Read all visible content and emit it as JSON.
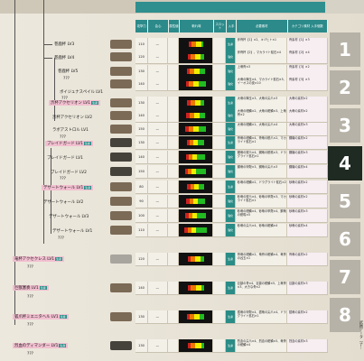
{
  "headers": [
    "攻撃力",
    "会心",
    "属性値",
    "斬れ味",
    "スロット",
    "入手",
    "必要素材",
    "カテゴリ素材\n入手個数"
  ],
  "colors": {
    "teal": "#2c8a8a",
    "pink": "#f2bfd0",
    "dark_tab": "#1f2a22",
    "grey_tab": "#b7b2a7"
  },
  "tree": [
    {
      "label": "巻鹿杯 LV3",
      "tag": ""
    },
    {
      "label": "巻鹿杯 LV4",
      "tag": ""
    },
    {
      "label": "巻鹿杯 LV5",
      "tag": ""
    },
    {
      "label": "ボイジュナスペイル LV1",
      "tag": ""
    },
    {
      "label": "渋杯アクセリオン LV1",
      "tag": "生産"
    },
    {
      "label": "渋杯アクセリオン LV2",
      "tag": ""
    },
    {
      "label": "ラボアストロル LV1",
      "tag": ""
    },
    {
      "label": "ブレイドガード LV1",
      "tag": "生産"
    },
    {
      "label": "ブレイドガード LV1",
      "tag": ""
    },
    {
      "label": "ブレイドガード LV2",
      "tag": ""
    },
    {
      "label": "デザートウォール LV1",
      "tag": "生産"
    },
    {
      "label": "デザートウォール LV2",
      "tag": ""
    },
    {
      "label": "デザートウォール LV3",
      "tag": ""
    },
    {
      "label": "デザートウォール LV1",
      "tag": ""
    },
    {
      "label": "竜杯アクセクレス LV1",
      "tag": "生産"
    },
    {
      "label": "巨獣塞奏 LV1",
      "tag": "生産"
    },
    {
      "label": "狐爪杯ミエニタヘル LV1",
      "tag": "生産"
    },
    {
      "label": "烈血のディマンダー LV1",
      "tag": "生産"
    }
  ],
  "qq": "???",
  "rows": [
    {
      "atk": "110",
      "crit": "—",
      "slot": "",
      "get": "生産",
      "mat": "斧骨杯【1】×2、キヅヒト×1",
      "cat": "骨素材【1】×3"
    },
    {
      "atk": "120",
      "crit": "—",
      "slot": "",
      "get": "強化",
      "mat": "斧骨杯【2】、マカライト鉱石×4",
      "cat": "骨素材【2】×4"
    },
    {
      "atk": "130",
      "crit": "—",
      "slot": "",
      "get": "強化",
      "mat": "上竜骨×3",
      "cat": "骨素材【3】×2"
    },
    {
      "atk": "140",
      "crit": "—",
      "slot": "",
      "get": "強化",
      "mat": "大竜の陣玉×4、マカライト鉱石×5、イーオスの皮×10",
      "cat": "骨素材【3】×3"
    },
    {
      "atk": "130",
      "crit": "—",
      "slot": "",
      "get": "生産",
      "mat": "大竜の陣玉×3、大竜の尖爪×3",
      "cat": "大竜の素材×2"
    },
    {
      "atk": "140",
      "crit": "—",
      "slot": "",
      "get": "強化",
      "mat": "大竜の紺鱗×2、大竜の紺鱗×3、上竜骨×2",
      "cat": "大竜の素材×2"
    },
    {
      "atk": "150",
      "crit": "—",
      "slot": "",
      "get": "強化",
      "mat": "大竜の紺鱗×1、大竜の尖爪×4",
      "cat": "大竜の素材×3"
    },
    {
      "atk": "130",
      "crit": "—",
      "slot": "",
      "get": "生産",
      "mat": "骨竜の紺鱗×4、骨竜の鋭爪×2、マカライト鉱石×1",
      "cat": "鋼機の素材×2"
    },
    {
      "atk": "140",
      "crit": "—",
      "slot": "",
      "get": "強化",
      "mat": "鋼竜の鋭爪×4、鋼竜の鋭嘴×3、ドラグライト鉱石×1",
      "cat": "鋼機の素材×3"
    },
    {
      "atk": "150",
      "crit": "—",
      "slot": "",
      "get": "強化",
      "mat": "鋼竜の甲殻×3、鋼竜の尖爪×3",
      "cat": "鋼機の素材×4"
    },
    {
      "atk": "80",
      "crit": "—",
      "slot": "",
      "get": "生産",
      "mat": "砂竜の紺鱗×2、ドラグライト鉱石×2",
      "cat": "砂竜の素材×2"
    },
    {
      "atk": "90",
      "crit": "—",
      "slot": "",
      "get": "強化",
      "mat": "砂竜の鋭爪×4、砂竜の甲殻×3、マカライト鉱石×1",
      "cat": "砂竜の素材×2"
    },
    {
      "atk": "100",
      "crit": "—",
      "slot": "",
      "get": "強化",
      "mat": "砂竜の紺鱗×4、砂竜の甲殻×4、鋼竜の鋭嘴×5",
      "cat": "砂竜の素材×3"
    },
    {
      "atk": "110",
      "crit": "—",
      "slot": "",
      "get": "強化",
      "mat": "砂竜の尖爪×4、砂竜の紺鱗×4",
      "cat": "砂竜の素材×4"
    },
    {
      "atk": "120",
      "crit": "—",
      "slot": "",
      "get": "生産",
      "mat": "骨竜の紺鱗×2、竜骨の紺鱗×4、竜骨の凶玉×1",
      "cat": "骨竜の素材×2"
    },
    {
      "atk": "140",
      "crit": "—",
      "slot": "",
      "get": "生産",
      "mat": "巨獣の骨×4、巨獣の紺鱗×5、上竜骨×3、大きな骨×2",
      "cat": "巨獣の素材×3"
    },
    {
      "atk": "130",
      "crit": "—",
      "slot": "",
      "get": "生産",
      "mat": "狐竜の甲殻×4、狐竜の尖爪×4、ドラグライト鉱石×1",
      "cat": "狐竜の素材×2"
    },
    {
      "atk": "130",
      "crit": "—",
      "slot": "",
      "get": "生産",
      "mat": "烈血の尖爪×4、烈血の紺鱗×5、竜骨の紺鱗×4",
      "cat": "烈血の素材×3"
    }
  ],
  "tabs": [
    "1",
    "2",
    "3",
    "4",
    "5",
    "6",
    "7",
    "8"
  ],
  "sidebar_caption": "武器データ（ナ..."
}
